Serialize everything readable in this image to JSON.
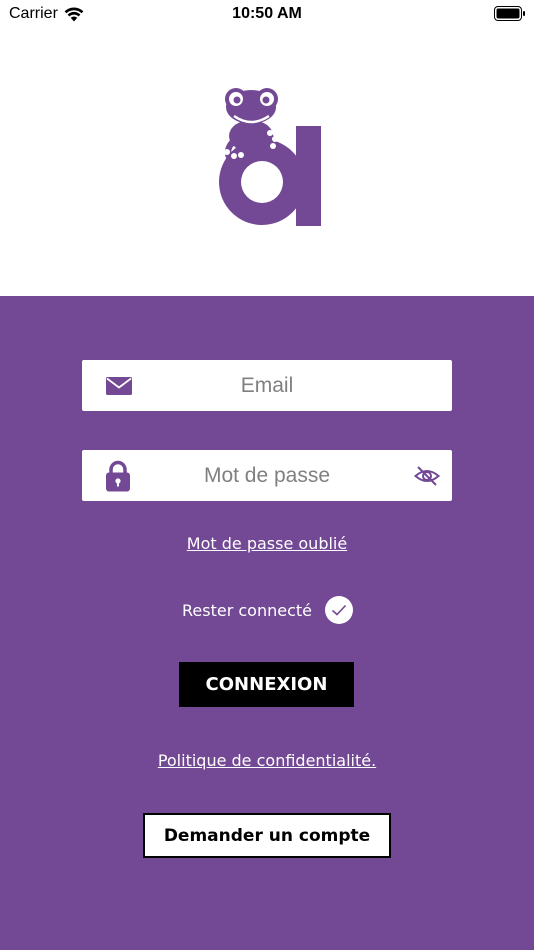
{
  "theme": {
    "accent": "#734894",
    "white": "#ffffff",
    "black": "#000000"
  },
  "status_bar": {
    "carrier": "Carrier",
    "time": "10:50 AM",
    "icons": {
      "wifi": "wifi-icon",
      "battery": "battery-icon"
    }
  },
  "logo": {
    "icon": "frog-letter-a-logo"
  },
  "form": {
    "email": {
      "placeholder": "Email",
      "value": "",
      "icon": "envelope-icon"
    },
    "password": {
      "placeholder": "Mot de passe",
      "value": "",
      "icon": "lock-icon",
      "toggle_icon": "eye-slash-icon"
    },
    "forgot_password": "Mot de passe oublié",
    "remember_me": {
      "label": "Rester connecté",
      "checked": true
    },
    "login_button": "CONNEXION",
    "privacy_link": "Politique de confidentialité.",
    "request_account_button": "Demander un compte"
  }
}
